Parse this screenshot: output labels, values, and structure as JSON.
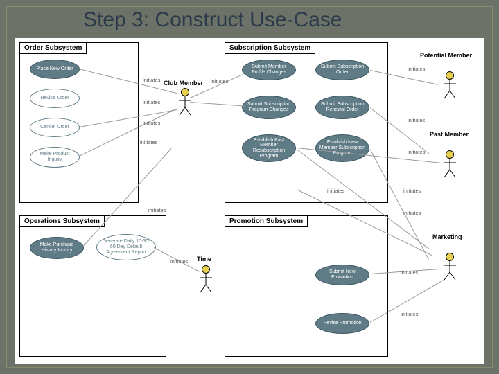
{
  "title": "Step 3: Construct Use-Case",
  "subsystems": {
    "order": {
      "label": "Order Subsystem"
    },
    "subscription": {
      "label": "Subscription Subsystem"
    },
    "operations": {
      "label": "Operations Subsystem"
    },
    "promotion": {
      "label": "Promotion Subsystem"
    }
  },
  "usecases": {
    "uc1": "Place New Order",
    "uc2": "Revise Order",
    "uc3": "Cancel Order",
    "uc4": "Make Product Inquiry",
    "uc5": "Make Purchase History Inquiry",
    "uc6": "Generate Daily 10-30-60 Day Default Agreement Report",
    "uc7": "Submit Member Profile Changes",
    "uc8": "Submit Subscription Order",
    "uc9": "Submit Subscription Program Changes",
    "uc10": "Submit Subscription Renewal Order",
    "uc11": "Establish Past Member Resubscription Program",
    "uc12": "Establish New Member Subscription Program",
    "uc13": "Submit New Promotion",
    "uc14": "Revise Promotion"
  },
  "actors": {
    "club": "Club Member",
    "time": "Time",
    "potential": "Potential Member",
    "past": "Past Member",
    "marketing": "Marketing"
  },
  "rel": "initiates"
}
